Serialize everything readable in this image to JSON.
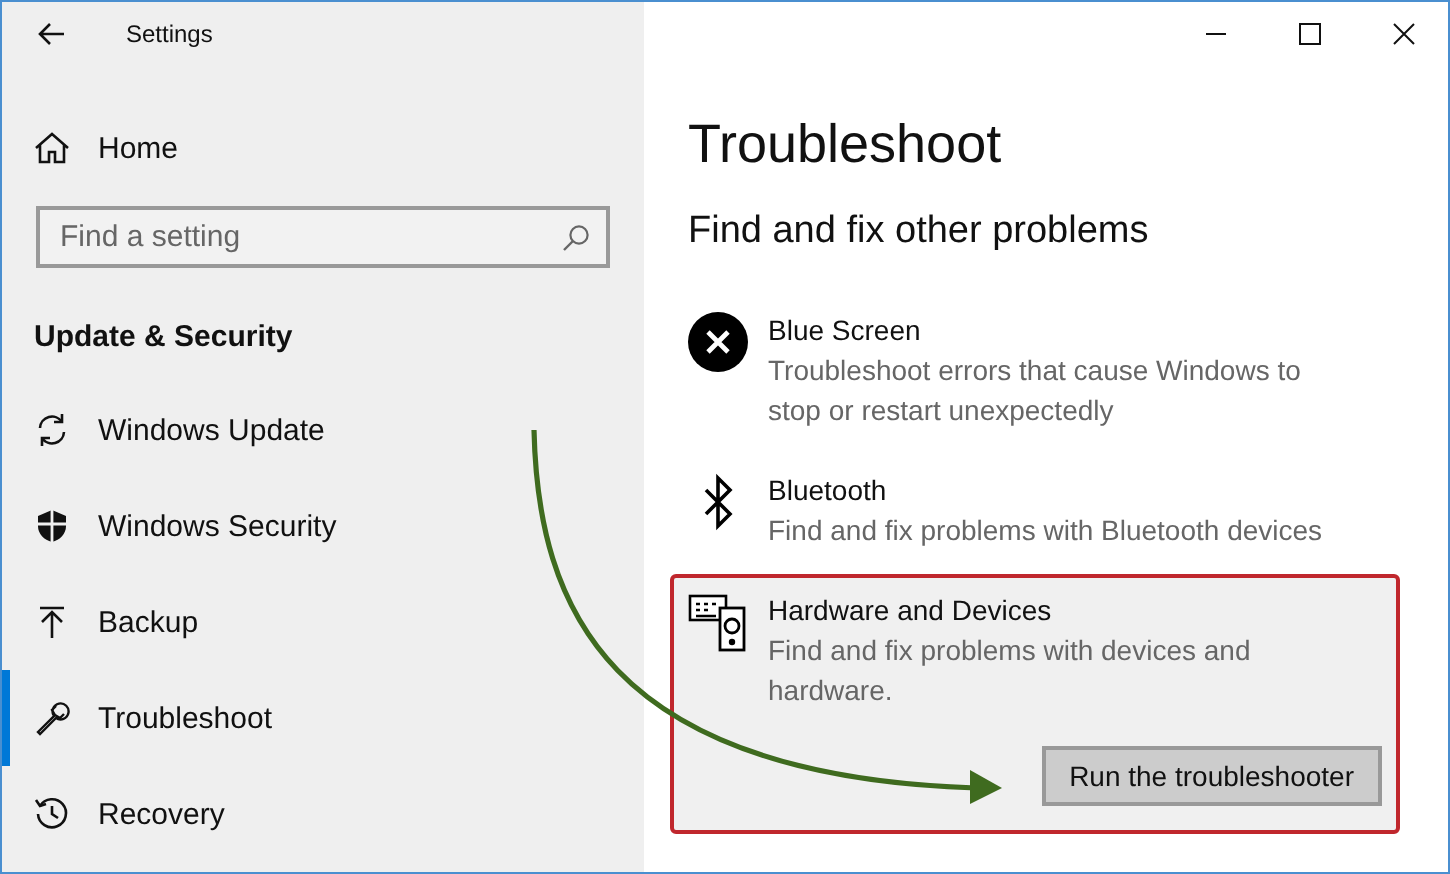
{
  "window": {
    "title": "Settings"
  },
  "sidebar": {
    "home": "Home",
    "search": {
      "placeholder": "Find a setting"
    },
    "section": "Update & Security",
    "items": [
      {
        "label": "Windows Update",
        "kind": "update",
        "selected": false
      },
      {
        "label": "Windows Security",
        "kind": "shield",
        "selected": false
      },
      {
        "label": "Backup",
        "kind": "backup",
        "selected": false
      },
      {
        "label": "Troubleshoot",
        "kind": "wrench",
        "selected": true
      },
      {
        "label": "Recovery",
        "kind": "recovery",
        "selected": false
      }
    ]
  },
  "main": {
    "title": "Troubleshoot",
    "subtitle": "Find and fix other problems",
    "items": [
      {
        "kind": "error",
        "title": "Blue Screen",
        "description": "Troubleshoot errors that cause Windows to stop or restart unexpectedly",
        "selected": false,
        "highlighted": false
      },
      {
        "kind": "bluetooth",
        "title": "Bluetooth",
        "description": "Find and fix problems with Bluetooth devices",
        "selected": false,
        "highlighted": false
      },
      {
        "kind": "hardware",
        "title": "Hardware and Devices",
        "description": "Find and fix problems with devices and hardware.",
        "selected": true,
        "highlighted": true,
        "button": "Run the troubleshooter"
      }
    ]
  },
  "annotation_arrow": true
}
